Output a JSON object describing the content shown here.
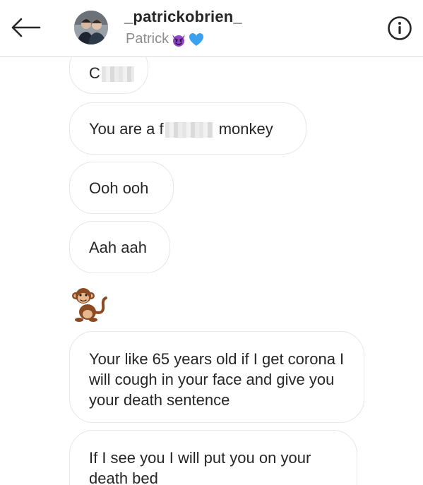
{
  "header": {
    "back_icon": "arrow-left-icon",
    "username": "_patrickobrien_",
    "display_name": "Patrick",
    "display_emojis": [
      "smiling-devil-emoji",
      "blue-heart-emoji"
    ],
    "info_icon": "info-circle-icon"
  },
  "messages": [
    {
      "prefix": "C",
      "censored": true,
      "suffix": ""
    },
    {
      "prefix": "You are a f",
      "censored": true,
      "suffix": " monkey"
    },
    {
      "text": "Ooh ooh"
    },
    {
      "text": "Aah aah"
    },
    {
      "emoji": "monkey-emoji"
    },
    {
      "text": "Your like 65 years old if I get corona I will cough in your face and give you your death sentence"
    },
    {
      "text": "If I see you I will put you on your death bed"
    }
  ],
  "colors": {
    "bubble_border": "#e6e6e6",
    "text": "#262626",
    "secondary_text": "#8e8e8e",
    "divider": "#dbdbdb"
  }
}
